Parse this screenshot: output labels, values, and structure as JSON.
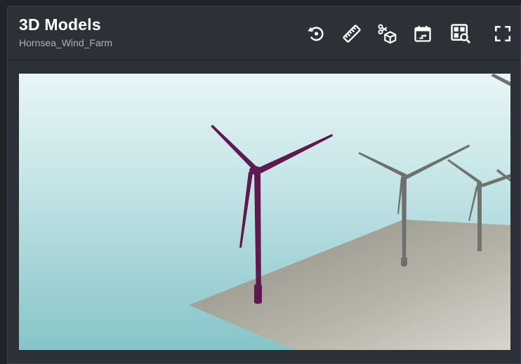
{
  "header": {
    "title": "3D Models",
    "subtitle": "Hornsea_Wind_Farm"
  },
  "toolbar": {
    "tools": [
      {
        "name": "reset-view",
        "icon": "reset-rotate-icon"
      },
      {
        "name": "measure",
        "icon": "ruler-icon"
      },
      {
        "name": "clip-model",
        "icon": "scissors-cube-icon"
      },
      {
        "name": "calendar",
        "icon": "calendar-icon"
      },
      {
        "name": "inspect",
        "icon": "grid-search-icon"
      },
      {
        "name": "fullscreen",
        "icon": "fullscreen-icon"
      }
    ]
  },
  "viewer": {
    "model": "wind-turbines",
    "selected_turbine_color": "#5e1a4f",
    "turbine_color": "#6f746e",
    "sky_top_color": "#eaf7f8",
    "sky_bottom_color": "#88c6c9",
    "ground_color": "#b8b5ab"
  }
}
